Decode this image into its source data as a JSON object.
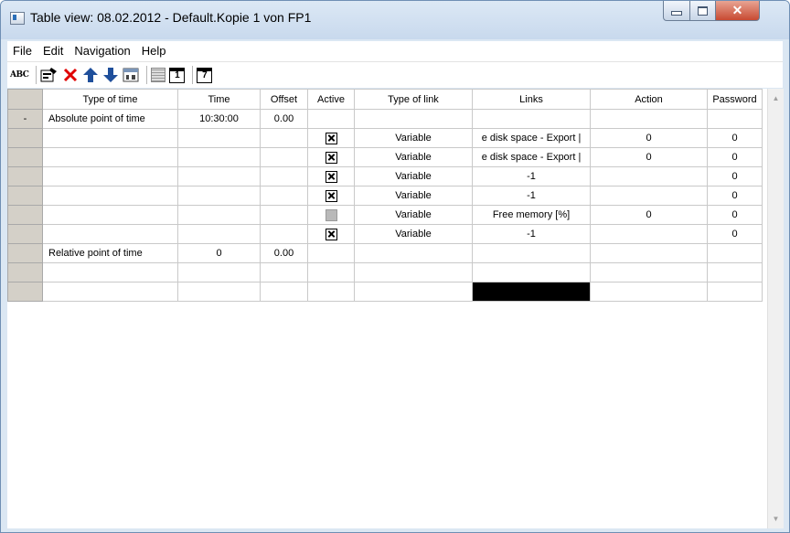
{
  "window": {
    "title": "Table view: 08.02.2012 - Default.Kopie 1 von FP1"
  },
  "menu": [
    "File",
    "Edit",
    "Navigation",
    "Help"
  ],
  "toolbar": {
    "abc_label": "ABC",
    "num1_label": "1",
    "num7_label": "7"
  },
  "table": {
    "columns": [
      "Type of time",
      "Time",
      "Offset",
      "Active",
      "Type of link",
      "Links",
      "Action",
      "Password"
    ],
    "rows": [
      {
        "rowhdr": "-",
        "type_of_time": "Absolute point of time",
        "time": "10:30:00",
        "offset": "0.00",
        "active": null,
        "type_of_link": "",
        "links": "",
        "action": "",
        "password": "",
        "links_black": false
      },
      {
        "rowhdr": "",
        "type_of_time": "",
        "time": "",
        "offset": "",
        "active": true,
        "type_of_link": "Variable",
        "links": "e disk space - Export |",
        "action": "0",
        "password": "0",
        "links_black": false
      },
      {
        "rowhdr": "",
        "type_of_time": "",
        "time": "",
        "offset": "",
        "active": true,
        "type_of_link": "Variable",
        "links": "e disk space - Export |",
        "action": "0",
        "password": "0",
        "links_black": false
      },
      {
        "rowhdr": "",
        "type_of_time": "",
        "time": "",
        "offset": "",
        "active": true,
        "type_of_link": "Variable",
        "links": "-1",
        "action": "",
        "password": "0",
        "links_black": false
      },
      {
        "rowhdr": "",
        "type_of_time": "",
        "time": "",
        "offset": "",
        "active": true,
        "type_of_link": "Variable",
        "links": "-1",
        "action": "",
        "password": "0",
        "links_black": false
      },
      {
        "rowhdr": "",
        "type_of_time": "",
        "time": "",
        "offset": "",
        "active": false,
        "type_of_link": "Variable",
        "links": "Free memory [%]",
        "action": "0",
        "password": "0",
        "links_black": false
      },
      {
        "rowhdr": "",
        "type_of_time": "",
        "time": "",
        "offset": "",
        "active": true,
        "type_of_link": "Variable",
        "links": "-1",
        "action": "",
        "password": "0",
        "links_black": false
      },
      {
        "rowhdr": "",
        "type_of_time": "Relative point of time",
        "time": "0",
        "offset": "0.00",
        "active": null,
        "type_of_link": "",
        "links": "",
        "action": "",
        "password": "",
        "links_black": false
      },
      {
        "rowhdr": "",
        "type_of_time": "",
        "time": "",
        "offset": "",
        "active": null,
        "type_of_link": "",
        "links": "",
        "action": "",
        "password": "",
        "links_black": false
      },
      {
        "rowhdr": "",
        "type_of_time": "",
        "time": "",
        "offset": "",
        "active": null,
        "type_of_link": "",
        "links": "",
        "action": "",
        "password": "",
        "links_black": true
      }
    ]
  },
  "colors": {
    "titlebar": "#c8d9ed",
    "close_button": "#c84a32",
    "row_header": "#d4d0c8"
  }
}
